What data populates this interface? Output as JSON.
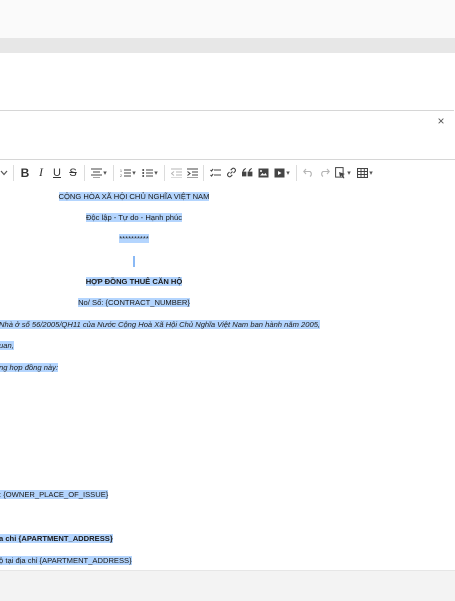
{
  "search": {
    "value": "",
    "clear_symbol": "×"
  },
  "toolbar": {
    "items": [
      "chevron-down",
      "bold",
      "italic",
      "underline",
      "strikethrough",
      "align",
      "numbered-list",
      "bulleted-list",
      "outdent",
      "indent",
      "todo-list",
      "link",
      "blockquote",
      "image",
      "media",
      "undo",
      "redo",
      "paste-from-office",
      "table"
    ],
    "bold_label": "B",
    "italic_label": "I",
    "underline_label": "U",
    "strike_label": "S"
  },
  "document": {
    "national_title": "CỘNG HÒA XÃ HỘI CHỦ NGHĨA VIỆT NAM",
    "motto": "Độc lập - Tự do - Hạnh phúc",
    "stars": "**********",
    "contract_title": "HỢP ĐỒNG THUÊ CĂN HỘ",
    "contract_no": "No/ Số: {CONTRACT_NUMBER}",
    "legal_basis": "Nhà ở số 56/2005/QH11 của Nước Cộng Hoà Xã Hội Chủ Nghĩa Việt Nam ban hành năm 2005,",
    "line_uan": "uan,",
    "line_agreement": "ng hợp đồng này:",
    "owner_issue": ": {OWNER_PLACE_OF_ISSUE}",
    "apt_address_bold": "a chỉ {APARTMENT_ADDRESS}",
    "apt_address": "ộ tại địa chỉ {APARTMENT_ADDRESS}"
  }
}
